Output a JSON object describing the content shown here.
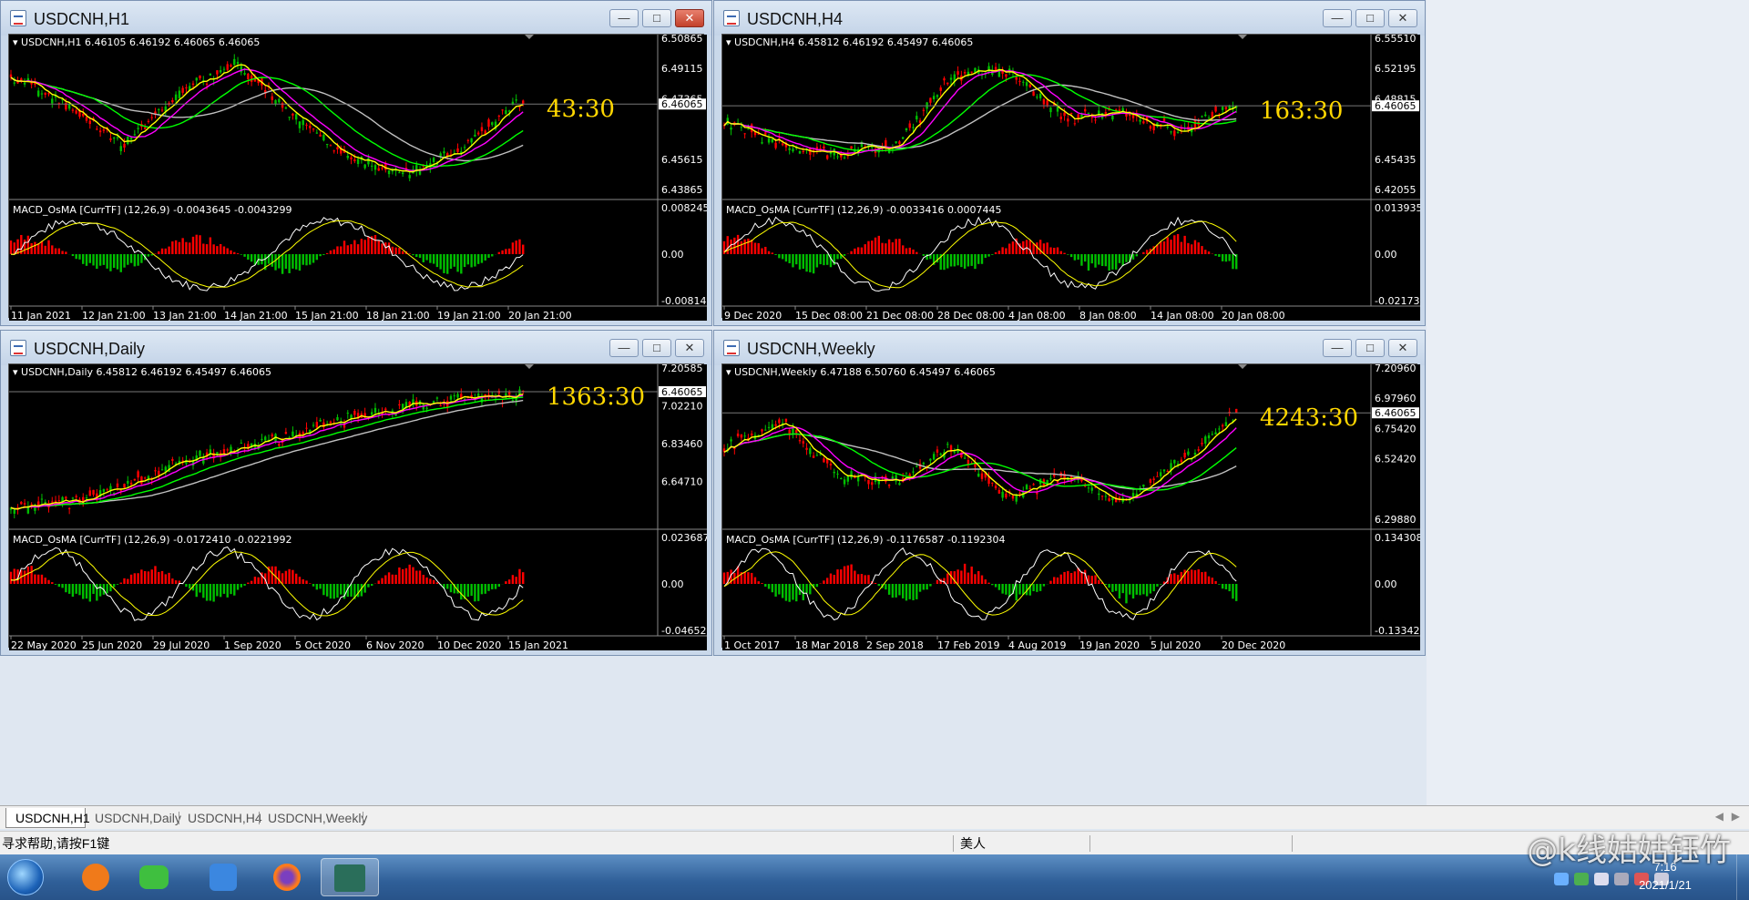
{
  "windows": [
    {
      "title": "USDCNH,H1",
      "close_active": true,
      "main": {
        "header": "USDCNH,H1  6.46105 6.46192 6.46065 6.46065",
        "price_labels": [
          "6.50865",
          "6.49115",
          "6.47365",
          "6.46065",
          "6.45615",
          "6.43865"
        ],
        "countdown": "43:30"
      },
      "macd": {
        "header": "MACD_OsMA [CurrTF] (12,26,9) -0.0043645 -0.0043299",
        "labels": [
          "0.0082457",
          "0.00",
          "-0.0081457"
        ]
      },
      "dates": [
        "11 Jan 2021",
        "12 Jan 21:00",
        "13 Jan 21:00",
        "14 Jan 21:00",
        "15 Jan 21:00",
        "18 Jan 21:00",
        "19 Jan 21:00",
        "20 Jan 21:00"
      ]
    },
    {
      "title": "USDCNH,H4",
      "close_active": false,
      "main": {
        "header": "USDCNH,H4  6.45812 6.46192 6.45497 6.46065",
        "price_labels": [
          "6.55510",
          "6.52195",
          "6.48815",
          "6.46065",
          "6.45435",
          "6.42055"
        ],
        "countdown": "163:30"
      },
      "macd": {
        "header": "MACD_OsMA [CurrTF] (12,26,9) -0.0033416 0.0007445",
        "labels": [
          "0.0139354",
          "0.00",
          "-0.0217328"
        ]
      },
      "dates": [
        "9 Dec 2020",
        "15 Dec 08:00",
        "21 Dec 08:00",
        "28 Dec 08:00",
        "4 Jan 08:00",
        "8 Jan 08:00",
        "14 Jan 08:00",
        "20 Jan 08:00"
      ]
    },
    {
      "title": "USDCNH,Daily",
      "close_active": false,
      "main": {
        "header": "USDCNH,Daily  6.45812 6.46192 6.45497 6.46065",
        "price_labels": [
          "7.20585",
          "7.02210",
          "6.83460",
          "6.64710",
          "6.46065"
        ],
        "countdown": "1363:30"
      },
      "macd": {
        "header": "MACD_OsMA [CurrTF] (12,26,9) -0.0172410 -0.0221992",
        "labels": [
          "0.023687",
          "0.00",
          "-0.046526"
        ]
      },
      "dates": [
        "22 May 2020",
        "25 Jun 2020",
        "29 Jul 2020",
        "1 Sep 2020",
        "5 Oct 2020",
        "6 Nov 2020",
        "10 Dec 2020",
        "15 Jan 2021"
      ]
    },
    {
      "title": "USDCNH,Weekly",
      "close_active": false,
      "main": {
        "header": "USDCNH,Weekly  6.47188 6.50760 6.45497 6.46065",
        "price_labels": [
          "7.20960",
          "6.97960",
          "6.75420",
          "6.52420",
          "6.46065",
          "6.29880"
        ],
        "countdown": "4243:30"
      },
      "macd": {
        "header": "MACD_OsMA [CurrTF] (12,26,9) -0.1176587 -0.1192304",
        "labels": [
          "0.1343086",
          "0.00",
          "-0.1334299"
        ]
      },
      "dates": [
        "1 Oct 2017",
        "18 Mar 2018",
        "2 Sep 2018",
        "17 Feb 2019",
        "4 Aug 2019",
        "19 Jan 2020",
        "5 Jul 2020",
        "20 Dec 2020"
      ]
    }
  ],
  "tabs": [
    "USDCNH,H1",
    "USDCNH,Daily",
    "USDCNH,H4",
    "USDCNH,Weekly"
  ],
  "status": {
    "help": "寻求帮助,请按F1键",
    "profile": "美人"
  },
  "taskbar": {
    "time": "7:16",
    "date": "2021/1/21"
  },
  "watermark": "@k线姑姑钰竹",
  "colors": {
    "bull": "#00c000",
    "bear": "#ff0000",
    "ma_fast": "#ffff00",
    "ma_mid": "#ff00ff",
    "ma_slow": "#00ff00",
    "ma_long": "#c0c0c0",
    "countdown": "#ffd700"
  }
}
